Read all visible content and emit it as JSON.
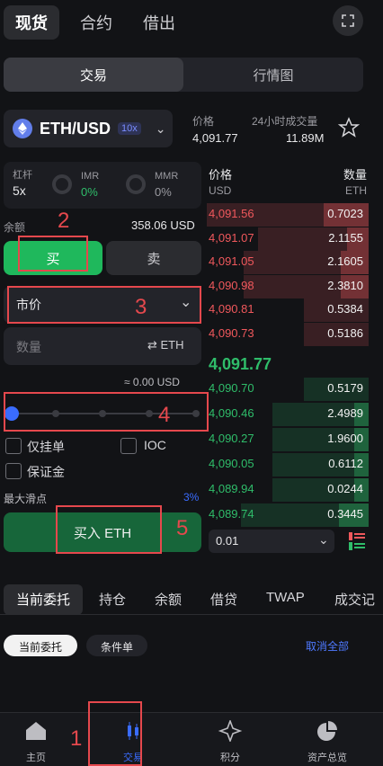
{
  "top_tabs": [
    "现货",
    "合约",
    "借出"
  ],
  "segment": [
    "交易",
    "行情图"
  ],
  "pair": {
    "name": "ETH/USD",
    "leverage": "10x"
  },
  "stats": {
    "price_label": "价格",
    "price_value": "4,091.77",
    "volume_label": "24小时成交量",
    "volume_value": "11.89M"
  },
  "margin": {
    "leverage_label": "杠杆",
    "leverage_value": "5x",
    "imr_label": "IMR",
    "imr_value": "0%",
    "mmr_label": "MMR",
    "mmr_value": "0%"
  },
  "balance": {
    "label": "余额",
    "value": "358.06 USD"
  },
  "side": {
    "buy": "买",
    "sell": "卖"
  },
  "order_type": "市价",
  "amount": {
    "placeholder": "数量",
    "unit": "⇄ ETH"
  },
  "est": "≈ 0.00 USD",
  "options": {
    "post_only": "仅挂单",
    "ioc": "IOC",
    "margin": "保证金"
  },
  "slippage": {
    "label": "最大滑点",
    "value": "3%"
  },
  "submit": "买入 ETH",
  "annotations": [
    "1",
    "2",
    "3",
    "4",
    "5"
  ],
  "orderbook": {
    "price_head": "价格",
    "price_unit": "USD",
    "qty_head": "数量",
    "qty_unit": "ETH",
    "asks": [
      {
        "price": "4,091.56",
        "qty": "0.7023",
        "depth": 1.0
      },
      {
        "price": "4,091.07",
        "qty": "2.1155",
        "depth": 0.47
      },
      {
        "price": "4,091.05",
        "qty": "2.1605",
        "depth": 0.62
      },
      {
        "price": "4,090.98",
        "qty": "2.3810",
        "depth": 0.62
      },
      {
        "price": "4,090.81",
        "qty": "0.5384",
        "depth": 0.0
      },
      {
        "price": "4,090.73",
        "qty": "0.5186",
        "depth": 0.0
      }
    ],
    "mid": "4,091.77",
    "bids": [
      {
        "price": "4,090.70",
        "qty": "0.5179",
        "depth": 0.0
      },
      {
        "price": "4,090.46",
        "qty": "2.4989",
        "depth": 0.32
      },
      {
        "price": "4,090.27",
        "qty": "1.9600",
        "depth": 0.32
      },
      {
        "price": "4,090.05",
        "qty": "0.6112",
        "depth": 0.32
      },
      {
        "price": "4,089.94",
        "qty": "0.0244",
        "depth": 0.32
      },
      {
        "price": "4,089.74",
        "qty": "0.3445",
        "depth": 0.65
      }
    ],
    "tick": "0.01"
  },
  "bottom_tabs": [
    "当前委托",
    "持仓",
    "余额",
    "借贷",
    "TWAP",
    "成交记"
  ],
  "filters": {
    "current": "当前委托",
    "conditional": "条件单",
    "cancel_all": "取消全部"
  },
  "nav": [
    "主页",
    "交易",
    "积分",
    "资产总览"
  ]
}
